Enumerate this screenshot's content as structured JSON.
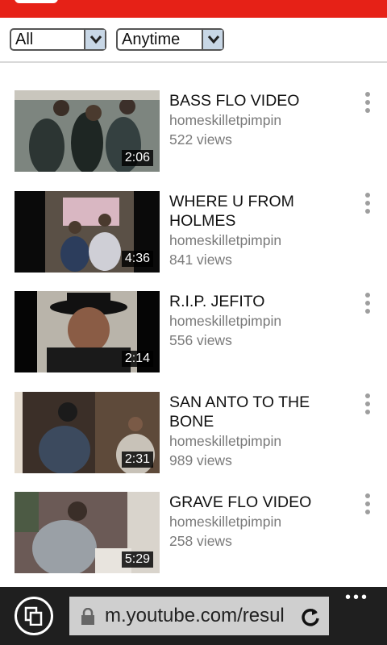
{
  "filters": {
    "type_value": "All",
    "time_value": "Anytime"
  },
  "results": [
    {
      "title": "BASS FLO VIDEO",
      "channel": "homeskilletpimpin",
      "views": "522 views",
      "duration": "2:06"
    },
    {
      "title": "WHERE U FROM HOLMES",
      "channel": "homeskilletpimpin",
      "views": "841 views",
      "duration": "4:36"
    },
    {
      "title": "R.I.P. JEFITO",
      "channel": "homeskilletpimpin",
      "views": "556 views",
      "duration": "2:14"
    },
    {
      "title": "SAN ANTO TO THE BONE",
      "channel": "homeskilletpimpin",
      "views": "989 views",
      "duration": "2:31"
    },
    {
      "title": "GRAVE FLO VIDEO",
      "channel": "homeskilletpimpin",
      "views": "258 views",
      "duration": "5:29"
    }
  ],
  "browser": {
    "url": "m.youtube.com/resul"
  },
  "icons": {
    "menu": "more-vert-icon",
    "tabs": "tabs-icon",
    "lock": "lock-icon",
    "refresh": "refresh-icon",
    "more": "more-horiz-icon"
  },
  "colors": {
    "brand_red": "#e62117",
    "browser_bar": "#1f1f1f",
    "address_bar": "#cfcfcf"
  }
}
